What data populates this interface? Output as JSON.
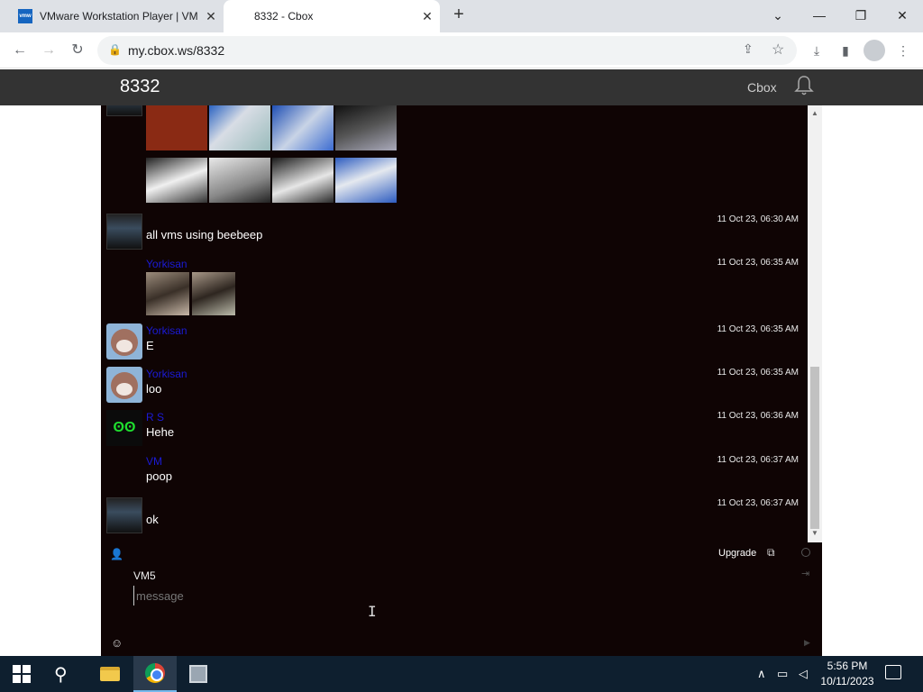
{
  "browser": {
    "tabs": [
      {
        "label": "VMware Workstation Player | VM",
        "favicon": "vmw"
      },
      {
        "label": "8332 - Cbox"
      }
    ],
    "url": "my.cbox.ws/8332"
  },
  "site": {
    "box_name": "8332",
    "brand": "Cbox"
  },
  "messages": [
    {
      "avatar": "vm-screenshot",
      "name": "",
      "text": "all vms using beebeep",
      "time": "11 Oct 23, 06:30 AM"
    },
    {
      "avatar": "none",
      "name": "Yorkisan",
      "text": "",
      "time": "11 Oct 23, 06:35 AM",
      "images": 2
    },
    {
      "avatar": "bear",
      "name": "Yorkisan",
      "text": "E",
      "time": "11 Oct 23, 06:35 AM"
    },
    {
      "avatar": "bear",
      "name": "Yorkisan",
      "text": "loo",
      "time": "11 Oct 23, 06:35 AM"
    },
    {
      "avatar": "green-creature",
      "name": "R S",
      "text": "Hehe",
      "time": "11 Oct 23, 06:36 AM"
    },
    {
      "avatar": "none",
      "name": "VM",
      "text": "poop",
      "time": "11 Oct 23, 06:37 AM"
    },
    {
      "avatar": "vm-screenshot",
      "name": "",
      "text": "ok",
      "time": "11 Oct 23, 06:37 AM"
    }
  ],
  "input": {
    "upgrade_label": "Upgrade",
    "nickname": "VM5",
    "placeholder": "message"
  },
  "taskbar": {
    "time": "5:56 PM",
    "date": "10/11/2023"
  },
  "colors": {
    "chat_bg": "#0f0404",
    "username": "#1b1bd6",
    "header_bg": "#333333",
    "taskbar_bg": "#0e1f2f"
  }
}
